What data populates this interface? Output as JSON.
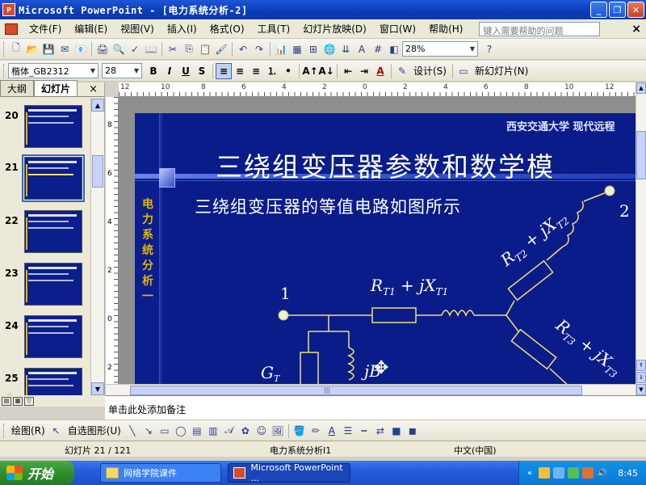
{
  "window": {
    "app_icon_label": "P",
    "title": "Microsoft PowerPoint - [电力系统分析-2]",
    "min": "_",
    "max": "❐",
    "close": "✕"
  },
  "menu": {
    "items": [
      "文件(F)",
      "编辑(E)",
      "视图(V)",
      "插入(I)",
      "格式(O)",
      "工具(T)",
      "幻灯片放映(D)",
      "窗口(W)",
      "帮助(H)"
    ],
    "help_placeholder": "键入需要帮助的问题",
    "doc_close": "×"
  },
  "standard_toolbar": {
    "zoom": "28%"
  },
  "format_toolbar": {
    "font": "楷体_GB2312",
    "size": "28",
    "bold": "B",
    "italic": "I",
    "underline": "U",
    "shadow": "S",
    "design_label": "设计(S)",
    "new_slide_label": "新幻灯片(N)"
  },
  "left_panel": {
    "tabs": [
      "大纲",
      "幻灯片"
    ],
    "close": "×",
    "slides": [
      {
        "num": "20",
        "selected": false
      },
      {
        "num": "21",
        "selected": true
      },
      {
        "num": "22",
        "selected": false
      },
      {
        "num": "23",
        "selected": false
      },
      {
        "num": "24",
        "selected": false
      },
      {
        "num": "25",
        "selected": false
      }
    ]
  },
  "ruler": {
    "h_labels": [
      "12",
      "10",
      "8",
      "6",
      "4",
      "2",
      "0",
      "2",
      "4",
      "6",
      "8",
      "10",
      "12"
    ],
    "v_labels": [
      "8",
      "6",
      "4",
      "2",
      "0",
      "2"
    ]
  },
  "slide": {
    "school": "西安交通大学  现代远程",
    "title": "三绕组变压器参数和数学模",
    "subtitle": "三绕组变压器的等值电路如图所示",
    "vertical_label": [
      "电",
      "力",
      "系",
      "统",
      "分",
      "析",
      "一"
    ],
    "node1": "1",
    "node2": "2",
    "rt1": "R",
    "rt1_sub": "T1",
    "jx1": " + jX",
    "jx1_sub": "T1",
    "rt2": "R",
    "rt2_sub": "T2",
    "jx2": " + jX",
    "jx2_sub": "T2",
    "rt3": "R",
    "rt3_sub": "T3",
    "jx3": " + jX",
    "jx3_sub": "T3",
    "gt": "G",
    "gt_sub": "T",
    "jb": "jB"
  },
  "notes": {
    "placeholder": "单击此处添加备注"
  },
  "drawing_toolbar": {
    "draw_label": "绘图(R)",
    "autoshape_label": "自选图形(U)"
  },
  "status": {
    "slide_pos": "幻灯片 21 / 121",
    "design": "电力系统分析I1",
    "language": "中文(中国)"
  },
  "taskbar": {
    "start": "开始",
    "buttons": [
      "网络学院课件",
      "Microsoft PowerPoint ..."
    ],
    "clock": "8:45"
  },
  "colors": {
    "slide_bg": "#0a1c8a",
    "accent_yellow": "#e6b400",
    "circuit_line": "#f0e070"
  }
}
